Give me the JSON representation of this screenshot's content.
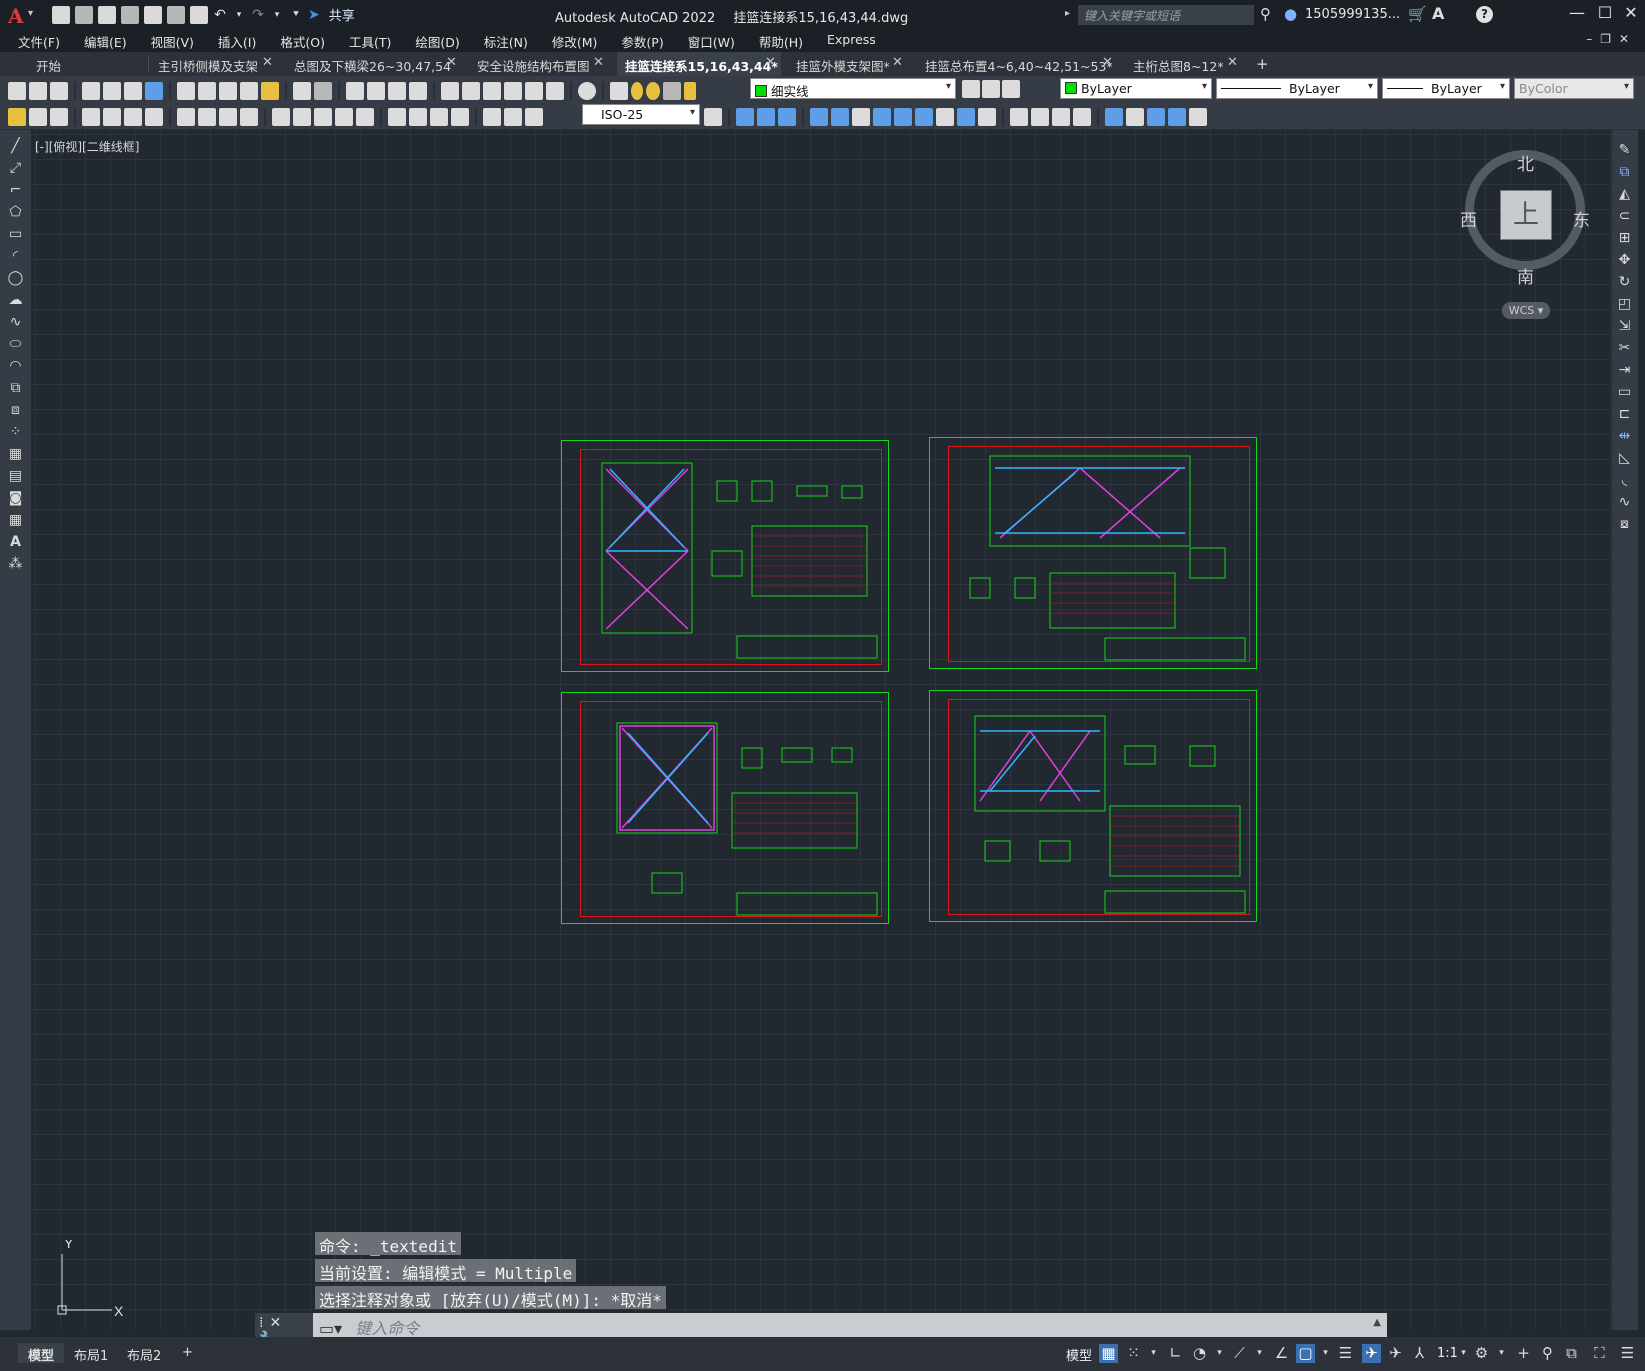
{
  "app": {
    "logo": "A",
    "title": "Autodesk AutoCAD 2022",
    "filename": "挂篮连接系15,16,43,44.dwg",
    "share_label": "共享",
    "search_placeholder": "键入关键字或短语",
    "user_name": "1505999135..."
  },
  "menu": [
    "文件(F)",
    "编辑(E)",
    "视图(V)",
    "插入(I)",
    "格式(O)",
    "工具(T)",
    "绘图(D)",
    "标注(N)",
    "修改(M)",
    "参数(P)",
    "窗口(W)",
    "帮助(H)",
    "Express"
  ],
  "tabs": [
    {
      "label": "开始",
      "closable": false,
      "active": false
    },
    {
      "label": "主引桥侧模及支架",
      "closable": true,
      "active": false
    },
    {
      "label": "总图及下横梁26~30,47,54",
      "closable": true,
      "active": false
    },
    {
      "label": "安全设施结构布置图",
      "closable": true,
      "active": false
    },
    {
      "label": "挂篮连接系15,16,43,44*",
      "closable": true,
      "active": true
    },
    {
      "label": "挂篮外模支架图*",
      "closable": true,
      "active": false
    },
    {
      "label": "挂篮总布置4~6,40~42,51~53*",
      "closable": true,
      "active": false
    },
    {
      "label": "主桁总图8~12*",
      "closable": true,
      "active": false
    }
  ],
  "toolbar": {
    "layer_name": "细实线",
    "color": "ByLayer",
    "linetype": "ByLayer",
    "lineweight": "ByLayer",
    "plotstyle": "ByColor",
    "dimstyle": "ISO-25"
  },
  "viewport": {
    "label": "[-][俯视][二维线框]"
  },
  "viewcube": {
    "face": "上",
    "north": "北",
    "south": "南",
    "east": "东",
    "west": "西",
    "wcs": "WCS"
  },
  "ucs": {
    "x": "X",
    "y": "Y"
  },
  "command": {
    "history": [
      "命令: _textedit",
      "当前设置: 编辑模式 = Multiple",
      "选择注释对象或 [放弃(U)/模式(M)]: *取消*"
    ],
    "placeholder": "键入命令"
  },
  "layouts": [
    {
      "label": "模型",
      "active": true
    },
    {
      "label": "布局1",
      "active": false
    },
    {
      "label": "布局2",
      "active": false
    }
  ],
  "status": {
    "model_label": "模型",
    "scale": "1:1"
  },
  "colors": {
    "sheet_border": "#18d418",
    "sheet_frame": "#d81818",
    "canvas_bg": "#212830",
    "geometry_cyan": "#2fb8ff",
    "geometry_magenta": "#e040e0"
  },
  "icons": {
    "app_menu": "autocad-logo",
    "search": "search-icon",
    "user": "user-icon",
    "cart": "cart-icon",
    "help": "help-icon"
  }
}
